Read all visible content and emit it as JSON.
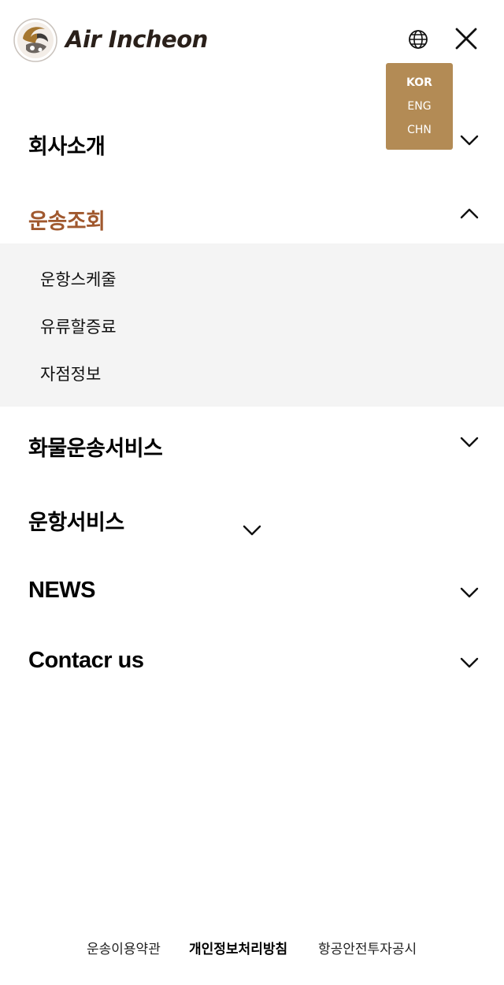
{
  "header": {
    "brand_name": "Air Incheon",
    "brand_color": "#2a201a",
    "accent_color": "#b38b55"
  },
  "language_menu": {
    "options": [
      {
        "label": "KOR",
        "selected": true
      },
      {
        "label": "ENG",
        "selected": false
      },
      {
        "label": "CHN",
        "selected": false
      }
    ]
  },
  "nav": {
    "active_color": "#a0582e",
    "items": [
      {
        "label": "회사소개",
        "expanded": false
      },
      {
        "label": "운송조회",
        "expanded": true,
        "children": [
          "운항스케줄",
          "유류할증료",
          "자점정보"
        ]
      },
      {
        "label": "화물운송서비스",
        "expanded": false
      },
      {
        "label": "운항서비스",
        "expanded": false
      },
      {
        "label": "NEWS",
        "expanded": false
      },
      {
        "label": "Contacr us",
        "expanded": false
      }
    ]
  },
  "footer": {
    "links": [
      "운송이용약관",
      "개인정보처리방침",
      "항공안전투자공시"
    ]
  }
}
